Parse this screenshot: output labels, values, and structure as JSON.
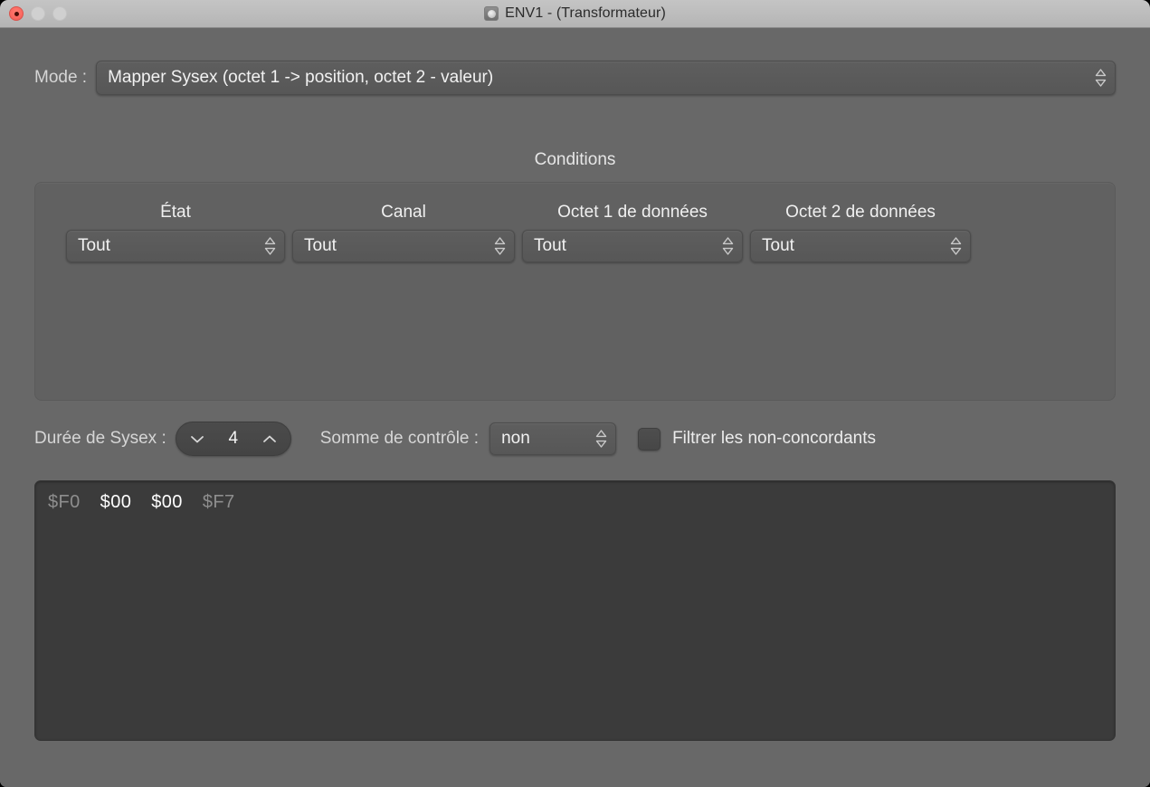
{
  "window": {
    "title": "ENV1 - (Transformateur)",
    "title_icon": "transformer-icon",
    "traffic_lights": {
      "close": "close-button",
      "minimize": "minimize-button",
      "zoom": "zoom-button"
    },
    "colors": {
      "titlebar": "#bcbcbc",
      "content_bg": "#686868",
      "group_bg": "#616161",
      "control_bg": "#585858",
      "data_bg": "#3b3b3b",
      "text_primary": "#f2f2f2",
      "text_label": "#d6d6d6",
      "text_dim": "#8e8e8e",
      "close_red": "#fb6860"
    }
  },
  "mode_row": {
    "label": "Mode :",
    "selected": "Mapper Sysex (octet 1 -> position, octet 2 - valeur)",
    "indicator": "chevron-updown-icon"
  },
  "conditions": {
    "title": "Conditions",
    "columns": [
      {
        "header": "État",
        "value": "Tout"
      },
      {
        "header": "Canal",
        "value": "Tout"
      },
      {
        "header": "Octet 1 de données",
        "value": "Tout"
      },
      {
        "header": "Octet 2 de données",
        "value": "Tout"
      }
    ]
  },
  "options": {
    "duree_label": "Durée de Sysex :",
    "duree_value": "4",
    "duree_decrement_icon": "chevron-down-icon",
    "duree_increment_icon": "chevron-up-icon",
    "somme_label": "Somme de contrôle :",
    "somme_value": "non",
    "filtre_checked": false,
    "filtre_label": "Filtrer les non-concordants"
  },
  "sysex_data": {
    "bytes": [
      {
        "text": "$F0",
        "state": "dim"
      },
      {
        "text": "$00",
        "state": "bright"
      },
      {
        "text": "$00",
        "state": "bright"
      },
      {
        "text": "$F7",
        "state": "dim"
      }
    ]
  }
}
